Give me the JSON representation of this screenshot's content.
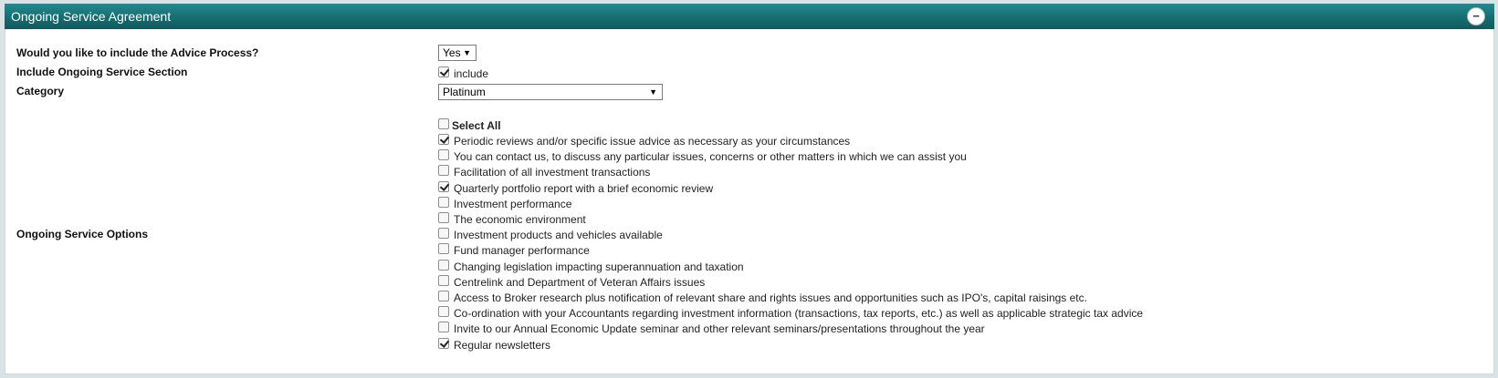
{
  "header": {
    "title": "Ongoing Service Agreement",
    "collapse_symbol": "−"
  },
  "form": {
    "advice_process": {
      "label": "Would you like to include the Advice Process?",
      "value": "Yes"
    },
    "include_section": {
      "label": "Include Ongoing Service Section",
      "checkbox_label": "include",
      "checked": true
    },
    "category": {
      "label": "Category",
      "value": "Platinum"
    },
    "service_options": {
      "label": "Ongoing Service Options",
      "select_all": "Select All",
      "items": [
        {
          "label": "Periodic reviews and/or specific issue advice as necessary as your circumstances",
          "checked": true
        },
        {
          "label": "You can contact us, to discuss any particular issues, concerns or other matters in which we can assist you",
          "checked": false
        },
        {
          "label": "Facilitation of all investment transactions",
          "checked": false
        },
        {
          "label": "Quarterly portfolio report with a brief economic review",
          "checked": true
        },
        {
          "label": "Investment performance",
          "checked": false
        },
        {
          "label": "The economic environment",
          "checked": false
        },
        {
          "label": "Investment products and vehicles available",
          "checked": false
        },
        {
          "label": "Fund manager performance",
          "checked": false
        },
        {
          "label": "Changing legislation impacting superannuation and taxation",
          "checked": false
        },
        {
          "label": "Centrelink and Department of Veteran Affairs issues",
          "checked": false
        },
        {
          "label": "Access to Broker research plus notification of relevant share and rights issues and opportunities such as IPO's, capital raisings etc.",
          "checked": false
        },
        {
          "label": "Co-ordination with your Accountants regarding investment information (transactions, tax reports, etc.) as well as applicable strategic tax advice",
          "checked": false
        },
        {
          "label": "Invite to our Annual Economic Update seminar and other relevant seminars/presentations throughout the year",
          "checked": false
        },
        {
          "label": "Regular newsletters",
          "checked": true
        }
      ]
    }
  },
  "icons": {
    "dropdown": "triangle-down-icon",
    "collapse": "minus-circle-icon"
  }
}
